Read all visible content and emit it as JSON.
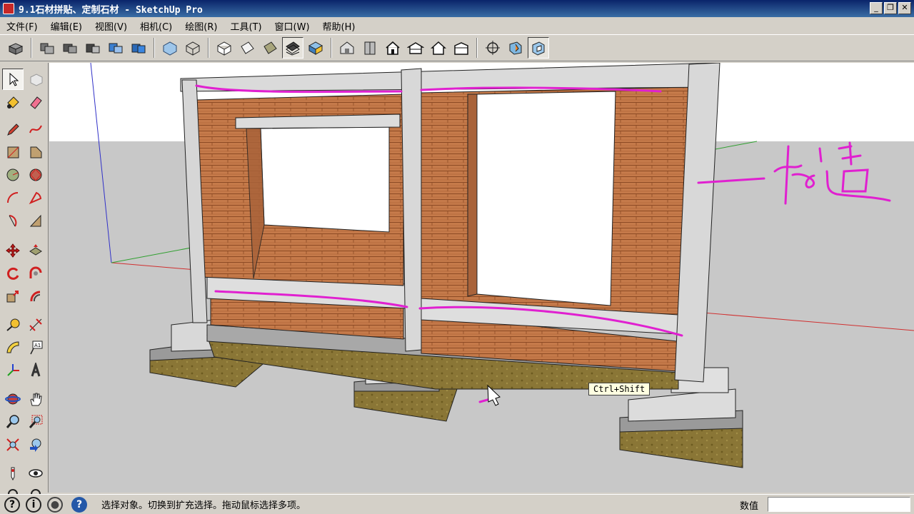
{
  "window": {
    "title": "9.1石材拼贴、定制石材 - SketchUp Pro",
    "minimize_label": "_",
    "restore_label": "❐",
    "close_label": "✕"
  },
  "menu": [
    {
      "label": "文件(F)"
    },
    {
      "label": "编辑(E)"
    },
    {
      "label": "视图(V)"
    },
    {
      "label": "相机(C)"
    },
    {
      "label": "绘图(R)"
    },
    {
      "label": "工具(T)"
    },
    {
      "label": "窗口(W)"
    },
    {
      "label": "帮助(H)"
    }
  ],
  "toolbar": [
    "model-info-icon",
    "iso-view-icon",
    "top-view-icon",
    "front-view-icon",
    "right-view-icon",
    "back-view-icon",
    "xray-style-icon",
    "wireframe-style-icon",
    "hidden-line-style-icon",
    "shaded-style-icon",
    "textured-style-icon",
    "monochrome-style-icon",
    "warehouse-icon",
    "component-icon",
    "house-icon",
    "house-gable-icon",
    "house-outline-icon",
    "house-flat-icon",
    "position-camera-icon",
    "section-plane-icon",
    "section-display-icon"
  ],
  "toolbar_active": [
    "textured-style-icon",
    "section-display-icon"
  ],
  "left_tools": [
    [
      "select-icon",
      "component-icon"
    ],
    [
      "paint-bucket-icon",
      "eraser-icon"
    ],
    [
      "pencil-icon",
      "freehand-icon"
    ],
    [
      "rectangle-icon",
      "rotated-rectangle-icon"
    ],
    [
      "circle-icon",
      "polygon-icon"
    ],
    [
      "arc-icon",
      "two-point-arc-icon"
    ],
    [
      "pie-icon",
      "three-point-arc-icon"
    ],
    [
      "move-icon",
      "push-pull-icon"
    ],
    [
      "rotate-icon",
      "follow-me-icon"
    ],
    [
      "scale-icon",
      "offset-icon"
    ],
    [
      "tape-measure-icon",
      "dimension-icon"
    ],
    [
      "protractor-icon",
      "text-icon"
    ],
    [
      "axes-icon",
      "3d-text-icon"
    ],
    [
      "orbit-icon",
      "pan-icon"
    ],
    [
      "zoom-icon",
      "zoom-window-icon"
    ],
    [
      "zoom-extents-icon",
      "previous-view-icon"
    ],
    [
      "walk-icon",
      "look-around-icon"
    ]
  ],
  "colors": {
    "sky": "#ffffff",
    "ground": "#c8c8c8",
    "brick": "#c57a4a",
    "concrete": "#d2d2d2",
    "soil": "#8a7636",
    "annotation": "#e020d0"
  },
  "viewport": {
    "tooltip": "Ctrl+Shift",
    "annotation": "构造"
  },
  "status": {
    "help_icon": "help-icon",
    "text": "选择对象。切换到扩充选择。拖动鼠标选择多项。",
    "measurements_label": "数值",
    "measurements_value": ""
  }
}
